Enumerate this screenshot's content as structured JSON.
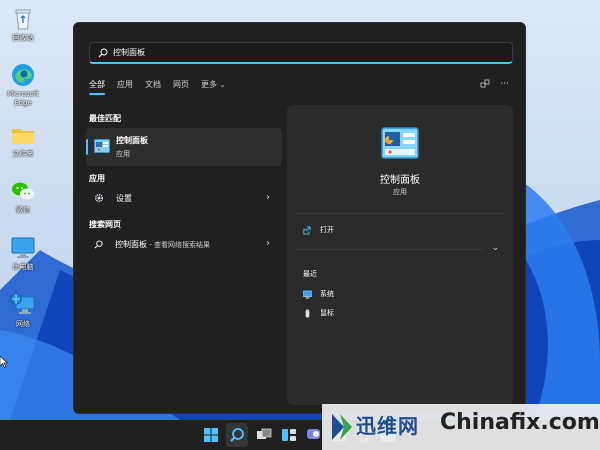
{
  "desktop": {
    "icons": [
      {
        "label": "回收站",
        "icon": "recycle-bin-icon"
      },
      {
        "label": "Microsoft Edge",
        "icon": "edge-icon"
      },
      {
        "label": "文件夹",
        "icon": "folder-icon"
      },
      {
        "label": "微信",
        "icon": "wechat-icon"
      },
      {
        "label": "此电脑",
        "icon": "this-pc-icon"
      },
      {
        "label": "网络",
        "icon": "network-icon"
      }
    ]
  },
  "search": {
    "query": "控制面板",
    "tabs": [
      "全部",
      "应用",
      "文档",
      "网页",
      "更多"
    ],
    "more_chevron": "⌄",
    "tools": [
      "share-icon",
      "more-icon"
    ],
    "more_glyph": "···"
  },
  "results": {
    "best_match_title": "最佳匹配",
    "best_match": {
      "name": "控制面板",
      "type": "应用"
    },
    "apps_title": "应用",
    "apps": [
      {
        "name": "设置"
      }
    ],
    "web_title": "搜索网页",
    "web": [
      {
        "name": "控制面板",
        "suffix": " - 查看网络搜索结果"
      }
    ]
  },
  "detail": {
    "name": "控制面板",
    "type": "应用",
    "actions": [
      {
        "label": "打开",
        "icon": "open-icon"
      }
    ],
    "recent_title": "最近",
    "recent": [
      {
        "label": "系统",
        "icon": "system-icon"
      },
      {
        "label": "鼠标",
        "icon": "mouse-icon"
      }
    ]
  },
  "taskbar": {
    "items": [
      "start-icon",
      "search-icon",
      "task-view-icon",
      "widgets-icon",
      "chat-icon",
      "file-explorer-icon",
      "store-icon",
      "control-panel-icon"
    ]
  },
  "watermark": {
    "cn": "迅维网",
    "en": "Chinafix.com"
  },
  "colors": {
    "accent": "#4cc2ff",
    "panel": "#202020",
    "card": "#2b2b2b"
  }
}
